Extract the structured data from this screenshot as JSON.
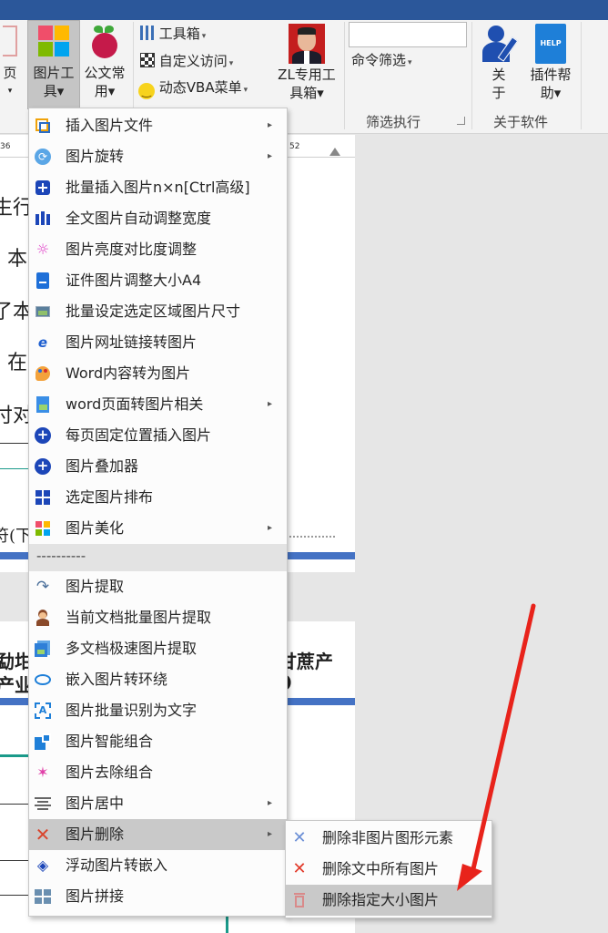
{
  "ribbon": {
    "page_btn": [
      "页",
      "▾"
    ],
    "image_tools": [
      "图片工",
      "具▾"
    ],
    "doc_common": [
      "公文常",
      "用▾"
    ],
    "toolbox": "工具箱",
    "custom_access": "自定义访问",
    "vba_menu": "动态VBA菜单",
    "zl_toolbox": [
      "ZL专用工",
      "具箱▾"
    ],
    "command_filter": "命令筛选",
    "about": [
      "关",
      "于"
    ],
    "plugin_help": [
      "插件帮",
      "助▾"
    ],
    "group_filter_exec": "筛选执行",
    "group_about_software": "关于软件",
    "help_icon_text": "HELP"
  },
  "ruler": {
    "left_num": "36",
    "right_num": "52"
  },
  "document": {
    "frag1": "生行",
    "frag2": "本",
    "frag3": "了本",
    "frag4": "在",
    "frag5": "付对",
    "frag6": "符(下",
    "frag7": "勐坩",
    "frag8": "产业",
    "frag9": "甘蔗产",
    "frag10": ")"
  },
  "main_menu": {
    "items": [
      {
        "label": "插入图片文件",
        "icon": "insert-image-file-icon",
        "submenu": true
      },
      {
        "label": "图片旋转",
        "icon": "rotate-icon",
        "submenu": true
      },
      {
        "label": "批量插入图片n×n[Ctrl高级]",
        "icon": "grid-insert-icon",
        "submenu": false
      },
      {
        "label": "全文图片自动调整宽度",
        "icon": "auto-width-icon",
        "submenu": false
      },
      {
        "label": "图片亮度对比度调整",
        "icon": "brightness-icon",
        "submenu": false
      },
      {
        "label": "证件图片调整大小A4",
        "icon": "id-card-icon",
        "submenu": false
      },
      {
        "label": "批量设定选定区域图片尺寸",
        "icon": "resize-image-icon",
        "submenu": false
      },
      {
        "label": "图片网址链接转图片",
        "icon": "ie-link-icon",
        "submenu": false
      },
      {
        "label": "Word内容转为图片",
        "icon": "palette-icon",
        "submenu": false
      },
      {
        "label": "word页面转图片相关",
        "icon": "page-image-icon",
        "submenu": true
      },
      {
        "label": "每页固定位置插入图片",
        "icon": "plus-circle-icon",
        "submenu": false
      },
      {
        "label": "图片叠加器",
        "icon": "plus-circle-icon-2",
        "submenu": false
      },
      {
        "label": "选定图片排布",
        "icon": "tiles-icon",
        "submenu": false
      },
      {
        "label": "图片美化",
        "icon": "beautify-icon",
        "submenu": true
      },
      {
        "label": "----------",
        "icon": "",
        "submenu": false,
        "divider": true
      },
      {
        "label": "图片提取",
        "icon": "extract-arrow-icon",
        "submenu": false
      },
      {
        "label": "当前文档批量图片提取",
        "icon": "person-icon",
        "submenu": false
      },
      {
        "label": "多文档极速图片提取",
        "icon": "multi-doc-icon",
        "submenu": false
      },
      {
        "label": "嵌入图片转环绕",
        "icon": "ellipse-icon",
        "submenu": false
      },
      {
        "label": "图片批量识别为文字",
        "icon": "ocr-icon",
        "submenu": false
      },
      {
        "label": "图片智能组合",
        "icon": "group-icon",
        "submenu": false
      },
      {
        "label": "图片去除组合",
        "icon": "ungroup-icon",
        "submenu": false
      },
      {
        "label": "图片居中",
        "icon": "align-center-icon",
        "submenu": true
      },
      {
        "label": "图片删除",
        "icon": "delete-x-icon",
        "submenu": true,
        "selected": true
      },
      {
        "label": "浮动图片转嵌入",
        "icon": "diamond-icon",
        "submenu": false
      },
      {
        "label": "图片拼接",
        "icon": "stitch-icon",
        "submenu": false
      }
    ]
  },
  "sub_menu": {
    "items": [
      {
        "label": "删除非图片图形元素",
        "icon": "cross-blue-icon"
      },
      {
        "label": "删除文中所有图片",
        "icon": "delete-red-icon"
      },
      {
        "label": "删除指定大小图片",
        "icon": "trash-icon",
        "highlighted": true
      }
    ]
  },
  "colors": {
    "title_bar": "#2b579a",
    "selection": "#c9c9c9",
    "annotation_arrow": "#e8231b",
    "doc_blue_bar": "#4472c4"
  }
}
